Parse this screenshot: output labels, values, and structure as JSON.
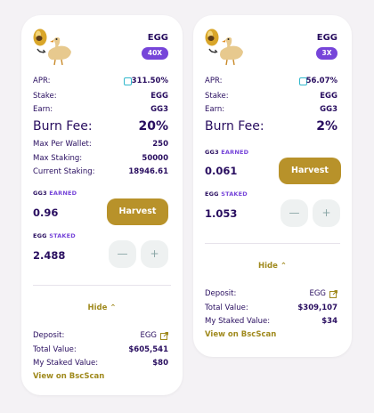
{
  "colors": {
    "primary": "#7645d9",
    "gold": "#b8922a",
    "text": "#280d5f"
  },
  "cards": [
    {
      "token": "EGG",
      "multiplier": "40X",
      "apr_label": "APR:",
      "apr_value": "311.50%",
      "stake_label": "Stake:",
      "stake_value": "EGG",
      "earn_label": "Earn:",
      "earn_value": "GG3",
      "burn_label": "Burn Fee:",
      "burn_value": "20%",
      "max_wallet_label": "Max Per Wallet:",
      "max_wallet_value": "250",
      "max_staking_label": "Max Staking:",
      "max_staking_value": "50000",
      "current_staking_label": "Current Staking:",
      "current_staking_value": "18946.61",
      "earned_token": "GG3",
      "earned_label": "EARNED",
      "earned_value": "0.96",
      "harvest_label": "Harvest",
      "staked_token": "EGG",
      "staked_label": "STAKED",
      "staked_value": "2.488",
      "minus": "—",
      "plus": "+",
      "hide_label": "Hide",
      "deposit_label": "Deposit:",
      "deposit_value": "EGG",
      "total_value_label": "Total Value:",
      "total_value": "$605,541",
      "my_staked_label": "My Staked Value:",
      "my_staked_value": "$80",
      "bsc_link": "View on BscScan"
    },
    {
      "token": "EGG",
      "multiplier": "3X",
      "apr_label": "APR:",
      "apr_value": "56.07%",
      "stake_label": "Stake:",
      "stake_value": "EGG",
      "earn_label": "Earn:",
      "earn_value": "GG3",
      "burn_label": "Burn Fee:",
      "burn_value": "2%",
      "earned_token": "GG3",
      "earned_label": "EARNED",
      "earned_value": "0.061",
      "harvest_label": "Harvest",
      "staked_token": "EGG",
      "staked_label": "STAKED",
      "staked_value": "1.053",
      "minus": "—",
      "plus": "+",
      "hide_label": "Hide",
      "deposit_label": "Deposit:",
      "deposit_value": "EGG",
      "total_value_label": "Total Value:",
      "total_value": "$309,107",
      "my_staked_label": "My Staked Value:",
      "my_staked_value": "$34",
      "bsc_link": "View on BscScan"
    }
  ]
}
